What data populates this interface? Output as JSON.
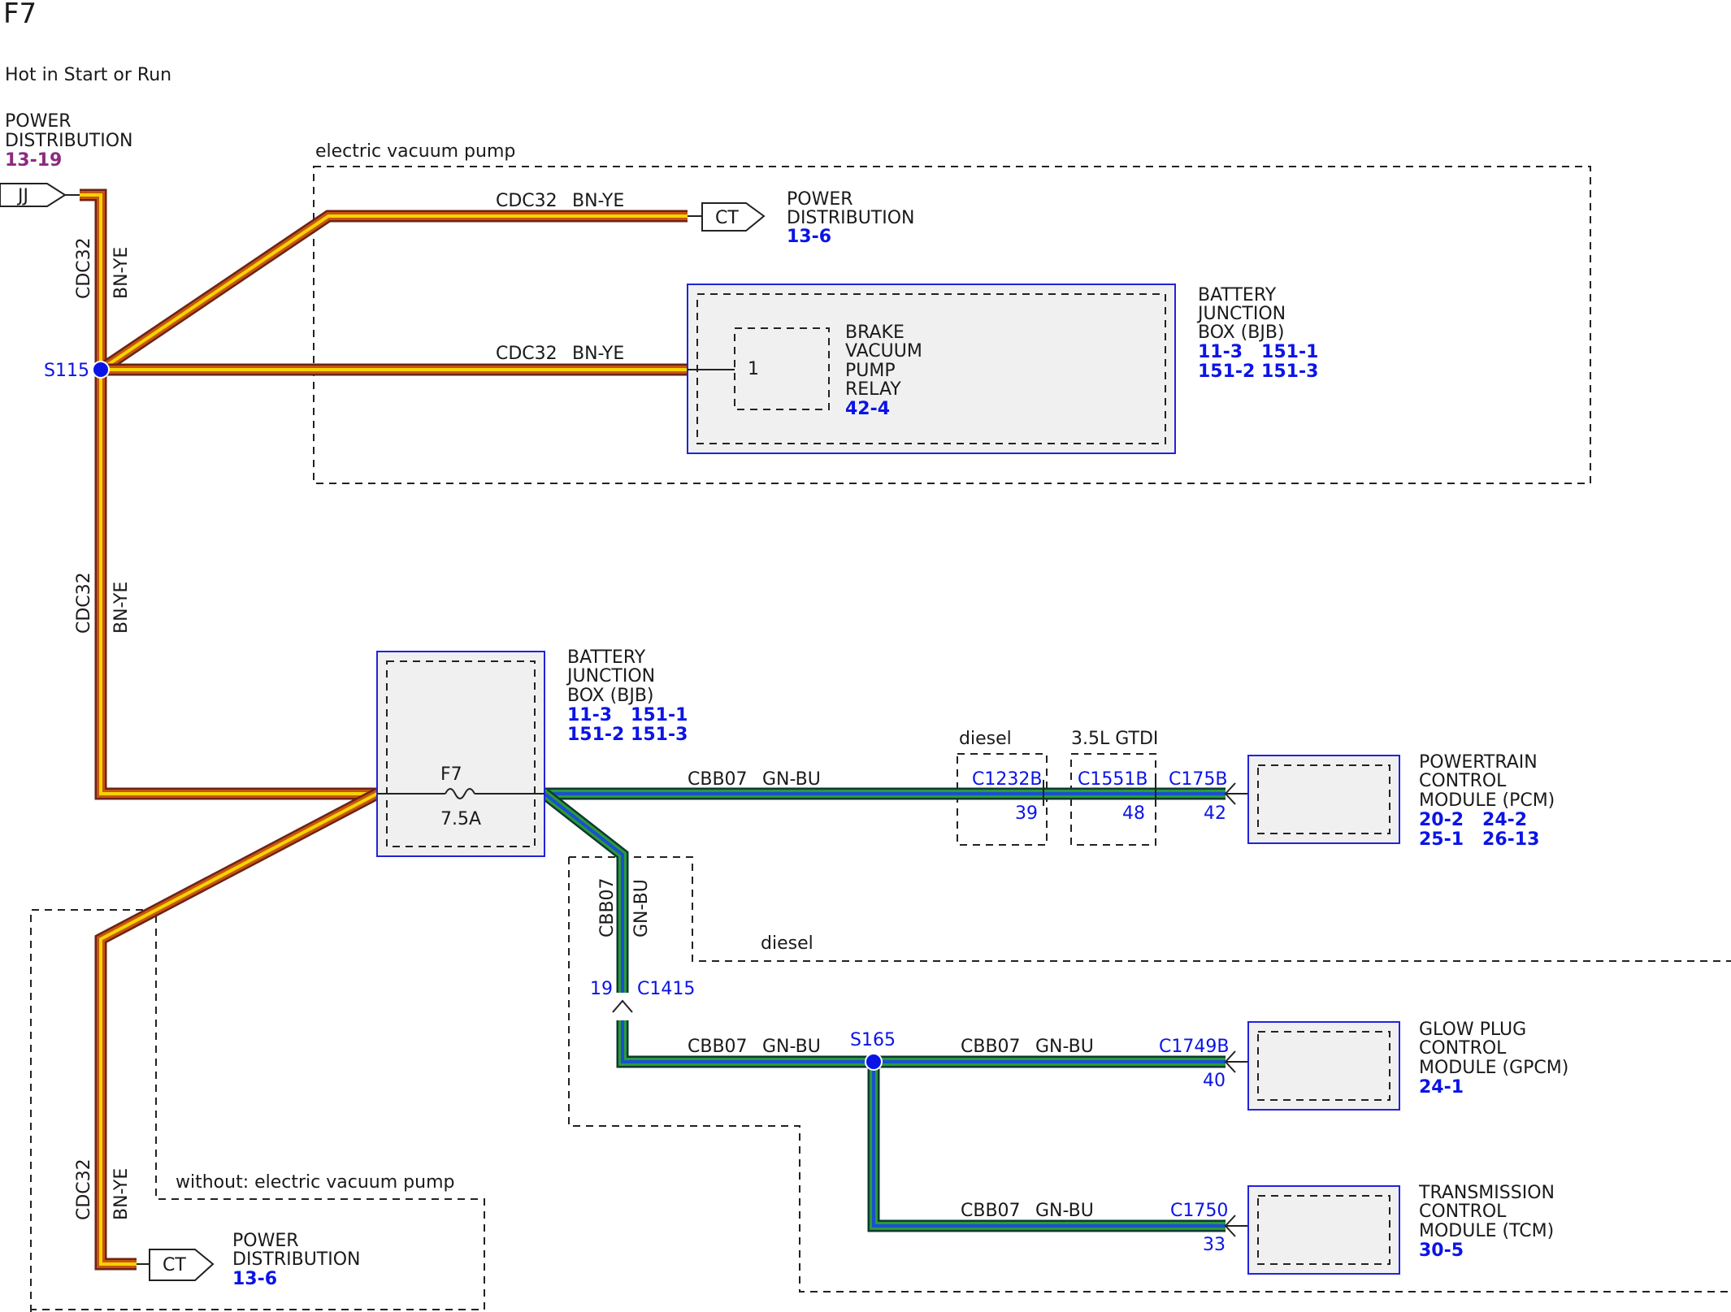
{
  "title": "F7",
  "subtitle": "Hot in Start or Run",
  "colors": {
    "wire_bn_ye_outer": "#6b2414",
    "wire_bn_ye_mid": "#c8540e",
    "wire_bn_ye_core": "#f5d400",
    "wire_gn_bu_outer": "#0d3a2e",
    "wire_gn_bu_mid": "#2a9a3a",
    "wire_gn_bu_core": "#1a50d0",
    "ref_blue": "#0b14e6",
    "ref_purple": "#8b2b7e",
    "module_border": "#2222dd",
    "module_fill": "#f0f0f0"
  },
  "source": {
    "label_line1": "POWER",
    "label_line2": "DISTRIBUTION",
    "ref": "13-19",
    "connector": "JJ"
  },
  "splices": {
    "s115": "S115",
    "s165": "S165"
  },
  "wires": {
    "cdc32": "CDC32",
    "bn_ye": "BN-YE",
    "cbb07": "CBB07",
    "gn_bu": "GN-BU"
  },
  "options": {
    "electric_vacuum_pump": "electric vacuum pump",
    "without_evp": "without: electric vacuum pump",
    "diesel_top": "diesel",
    "gtdi": "3.5L GTDI",
    "diesel_region": "diesel"
  },
  "ct_top": {
    "connector": "CT",
    "line1": "POWER",
    "line2": "DISTRIBUTION",
    "ref": "13-6"
  },
  "ct_bottom": {
    "connector": "CT",
    "line1": "POWER",
    "line2": "DISTRIBUTION",
    "ref": "13-6"
  },
  "bjb_relay": {
    "line1": "BATTERY",
    "line2": "JUNCTION",
    "line3": "BOX (BJB)",
    "refs_row1": "11-3   151-1",
    "refs_row2": "151-2 151-3",
    "pin": "1",
    "relay_line1": "BRAKE",
    "relay_line2": "VACUUM",
    "relay_line3": "PUMP",
    "relay_line4": "RELAY",
    "relay_ref": "42-4"
  },
  "bjb_fuse": {
    "line1": "BATTERY",
    "line2": "JUNCTION",
    "line3": "BOX (BJB)",
    "refs_row1": "11-3   151-1",
    "refs_row2": "151-2 151-3",
    "fuse_name": "F7",
    "fuse_rating": "7.5A"
  },
  "inline_connectors": {
    "c1232b": "C1232B",
    "c1232b_pin": "39",
    "c1551b": "C1551B",
    "c1551b_pin": "48",
    "c175b": "C175B",
    "c175b_pin": "42",
    "c1415": "C1415",
    "c1415_pin": "19",
    "c1749b": "C1749B",
    "c1749b_pin": "40",
    "c1750": "C1750",
    "c1750_pin": "33"
  },
  "pcm": {
    "line1": "POWERTRAIN",
    "line2": "CONTROL",
    "line3": "MODULE (PCM)",
    "refs_row1": "20-2   24-2",
    "refs_row2": "25-1   26-13"
  },
  "gpcm": {
    "line1": "GLOW PLUG",
    "line2": "CONTROL",
    "line3": "MODULE (GPCM)",
    "ref": "24-1"
  },
  "tcm": {
    "line1": "TRANSMISSION",
    "line2": "CONTROL",
    "line3": "MODULE (TCM)",
    "ref": "30-5"
  }
}
